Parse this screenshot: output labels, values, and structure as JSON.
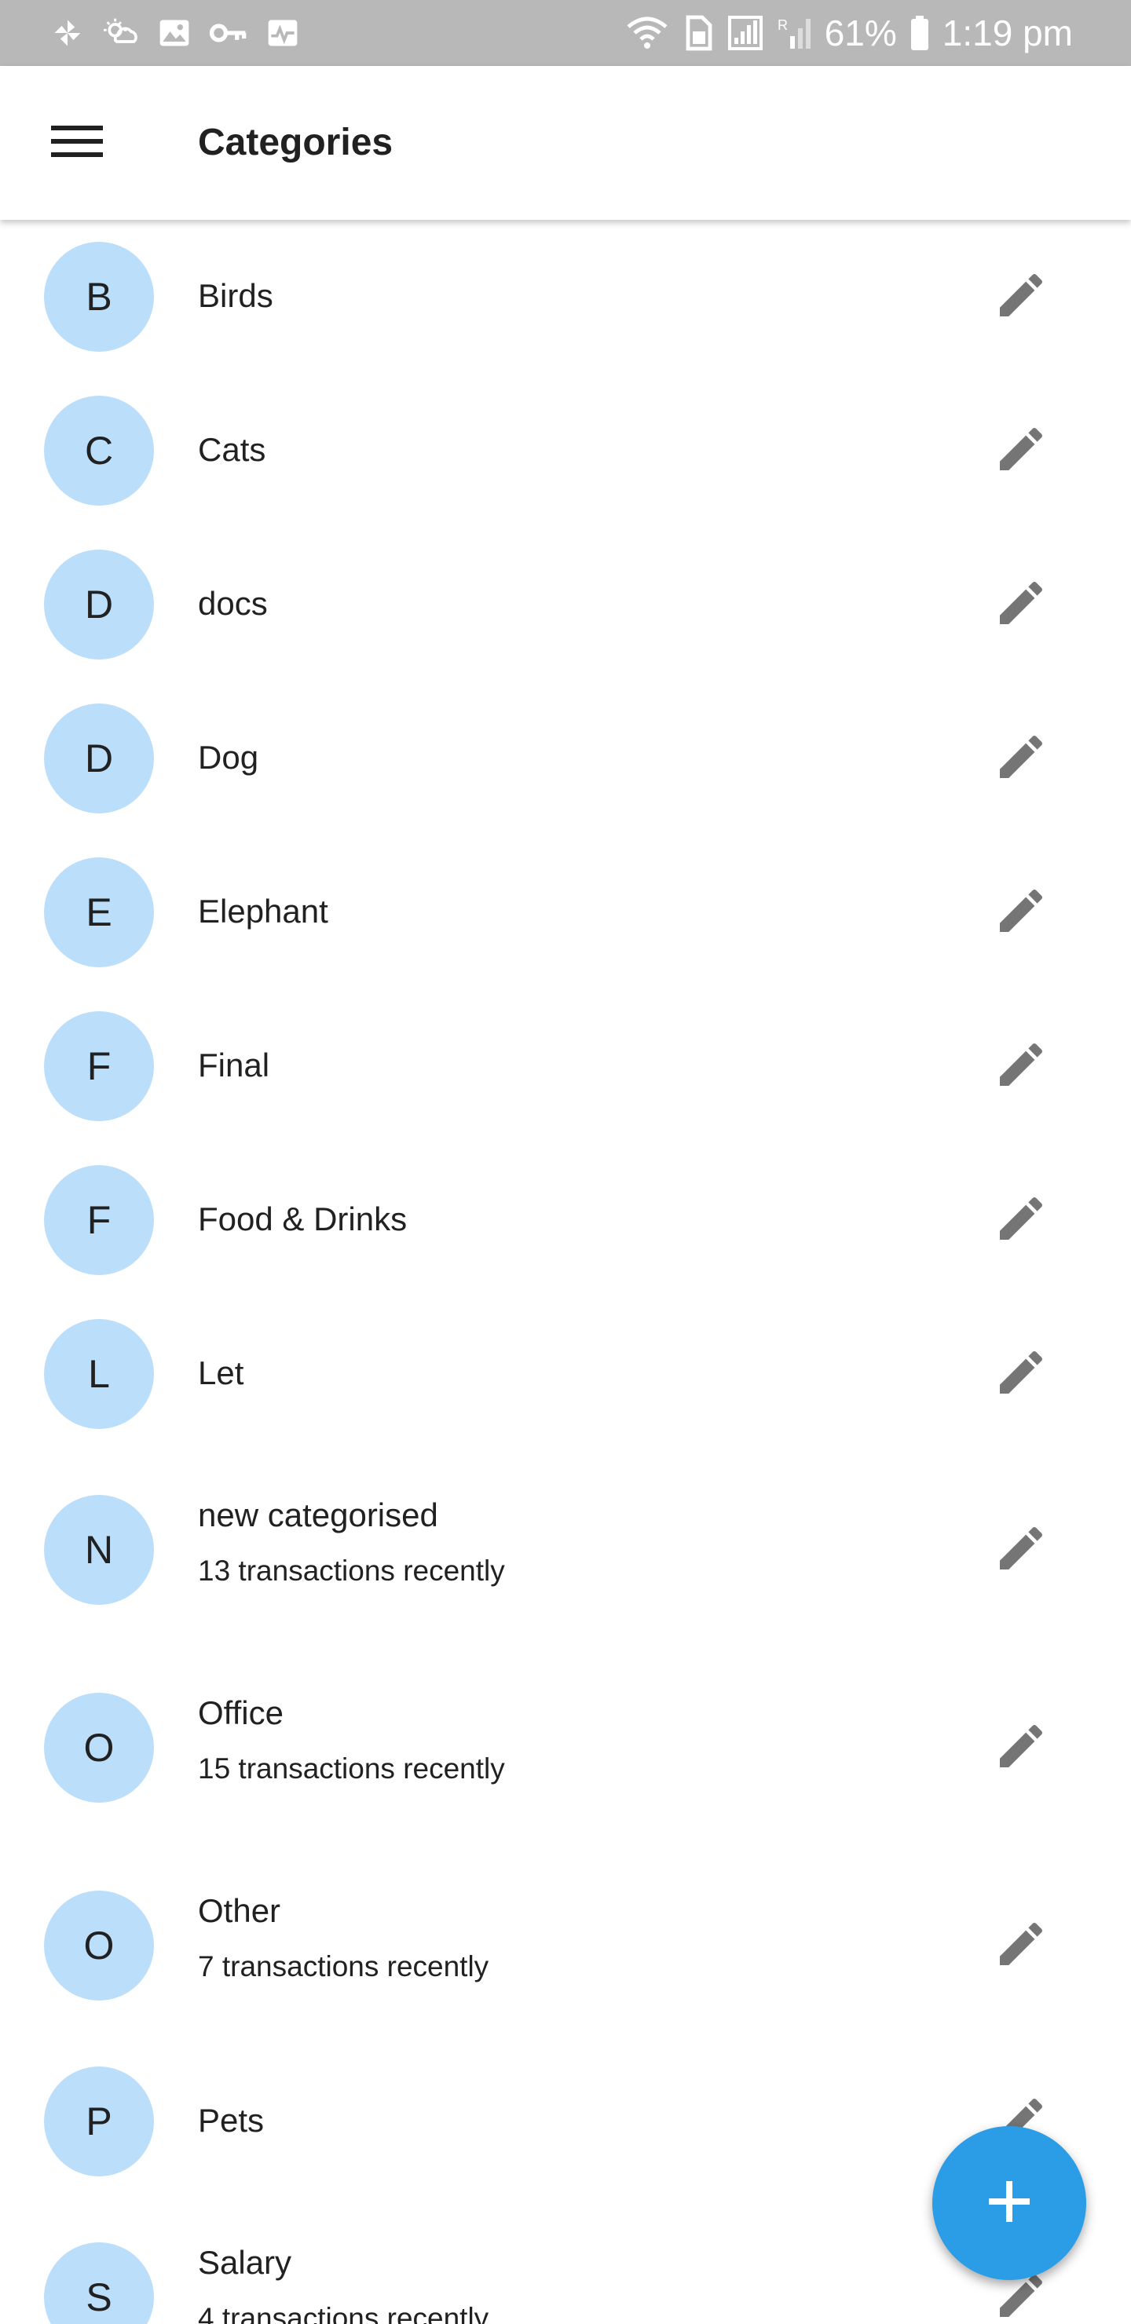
{
  "status_bar": {
    "battery_text": "61%",
    "time": "1:19 pm",
    "left_icons": [
      "pinwheel-icon",
      "weather-icon",
      "image-icon",
      "key-icon",
      "activity-icon"
    ],
    "right_icons": [
      "wifi-icon",
      "sim-icon",
      "signal-icon",
      "roaming-signal-icon",
      "battery-icon"
    ]
  },
  "app_bar": {
    "title": "Categories",
    "menu_icon": "hamburger-menu-icon"
  },
  "colors": {
    "avatar_bg": "#bbdefb",
    "fab_bg": "#2b9ce6",
    "edit_icon": "#757575",
    "status_bar_bg": "#b8b8b8"
  },
  "categories": [
    {
      "letter": "B",
      "name": "Birds",
      "subtitle": ""
    },
    {
      "letter": "C",
      "name": "Cats",
      "subtitle": ""
    },
    {
      "letter": "D",
      "name": "docs",
      "subtitle": ""
    },
    {
      "letter": "D",
      "name": "Dog",
      "subtitle": ""
    },
    {
      "letter": "E",
      "name": "Elephant",
      "subtitle": ""
    },
    {
      "letter": "F",
      "name": "Final",
      "subtitle": ""
    },
    {
      "letter": "F",
      "name": "Food & Drinks",
      "subtitle": ""
    },
    {
      "letter": "L",
      "name": "Let",
      "subtitle": ""
    },
    {
      "letter": "N",
      "name": "new categorised",
      "subtitle": "13 transactions recently"
    },
    {
      "letter": "O",
      "name": "Office",
      "subtitle": "15 transactions recently"
    },
    {
      "letter": "O",
      "name": "Other",
      "subtitle": "7 transactions recently"
    },
    {
      "letter": "P",
      "name": "Pets",
      "subtitle": ""
    },
    {
      "letter": "S",
      "name": "Salary",
      "subtitle": "4 transactions recently"
    }
  ],
  "fab": {
    "icon": "plus-icon"
  }
}
